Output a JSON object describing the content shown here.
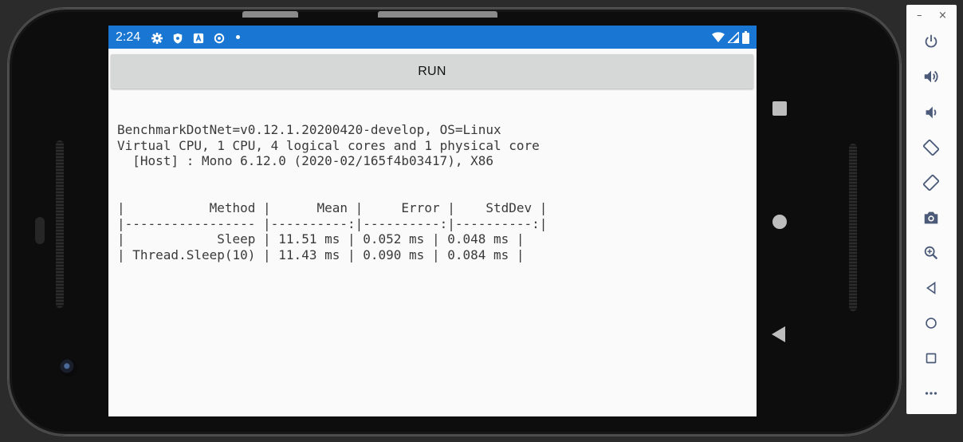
{
  "status_bar": {
    "time": "2:24",
    "left_icons": [
      "gear-icon",
      "shield-icon",
      "letter-a-icon",
      "sync-icon"
    ],
    "right_icons": [
      "wifi-icon",
      "signal-icon",
      "battery-icon"
    ]
  },
  "app": {
    "run_button_label": "RUN",
    "output_text": "BenchmarkDotNet=v0.12.1.20200420-develop, OS=Linux\nVirtual CPU, 1 CPU, 4 logical cores and 1 physical core\n  [Host] : Mono 6.12.0 (2020-02/165f4b03417), X86\n\n\n|           Method |      Mean |     Error |    StdDev |\n|----------------- |----------:|----------:|----------:|\n|            Sleep | 11.51 ms | 0.052 ms | 0.048 ms |\n| Thread.Sleep(10) | 11.43 ms | 0.090 ms | 0.084 ms |"
  },
  "phone_nav": [
    "overview-square",
    "home-circle",
    "back-triangle"
  ],
  "emulator_toolbar": {
    "window_controls": {
      "minimize": "–",
      "close": "×"
    },
    "tools": [
      "power-icon",
      "volume-up-icon",
      "volume-down-icon",
      "rotate-left-icon",
      "rotate-right-icon",
      "camera-icon",
      "zoom-icon",
      "back-icon",
      "home-icon",
      "overview-icon",
      "more-icon"
    ]
  },
  "colors": {
    "status_bar": "#1976d2",
    "screen_background": "#fafafa",
    "button_background": "#d6d7d7",
    "toolbar_icon": "#4a5a78"
  }
}
